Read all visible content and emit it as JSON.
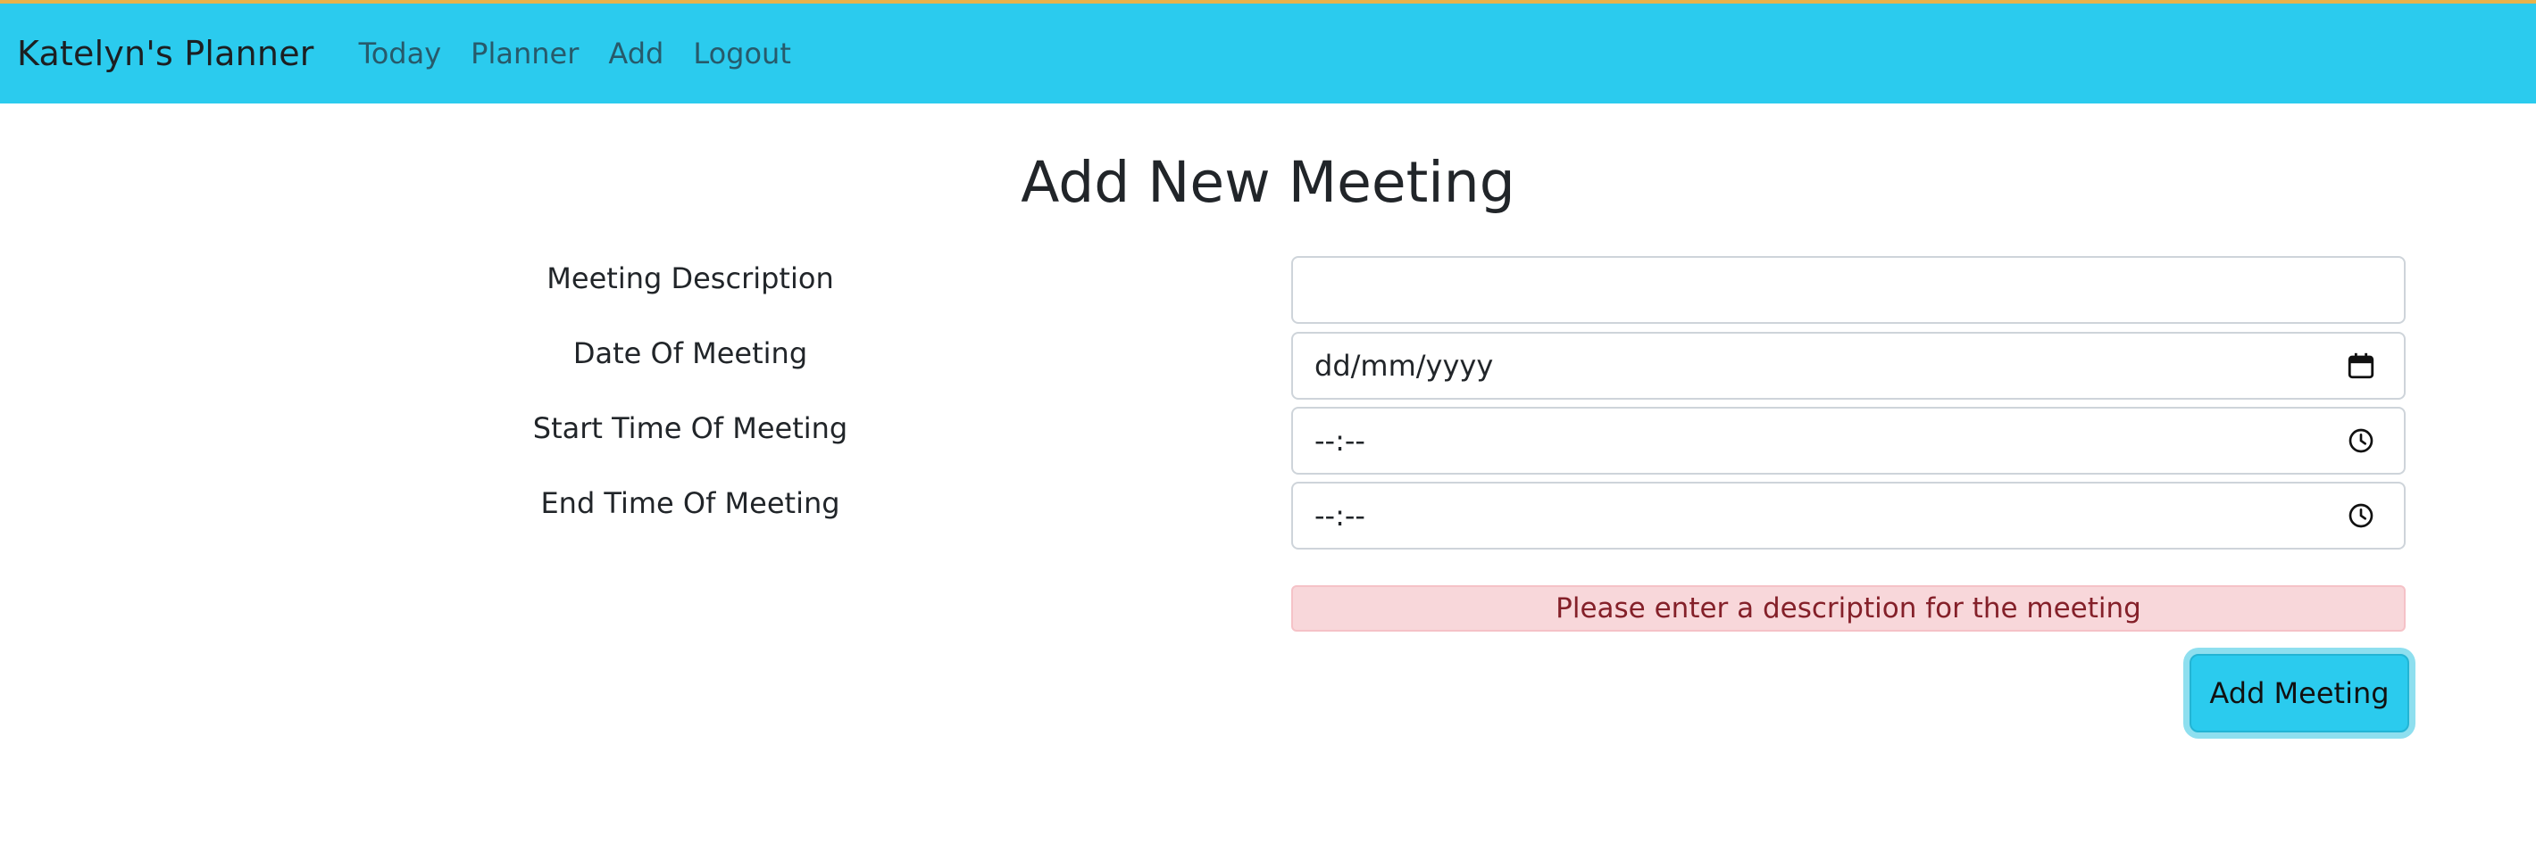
{
  "nav": {
    "brand": "Katelyn's Planner",
    "links": [
      "Today",
      "Planner",
      "Add",
      "Logout"
    ]
  },
  "page": {
    "title": "Add New Meeting"
  },
  "form": {
    "description_label": "Meeting Description",
    "description_value": "",
    "date_label": "Date Of Meeting",
    "date_placeholder": "dd/mm/yyyy",
    "start_label": "Start Time Of Meeting",
    "start_placeholder": "--:--",
    "end_label": "End Time Of Meeting",
    "end_placeholder": "--:--",
    "error_message": "Please enter a description for the meeting",
    "submit_label": "Add Meeting"
  },
  "icons": {
    "date": "calendar-icon",
    "start": "clock-icon",
    "end": "clock-icon"
  },
  "colors": {
    "navbar": "#2bcbee",
    "alert_bg": "#f8d7da",
    "alert_text": "#842029",
    "button": "#2bcbee"
  }
}
